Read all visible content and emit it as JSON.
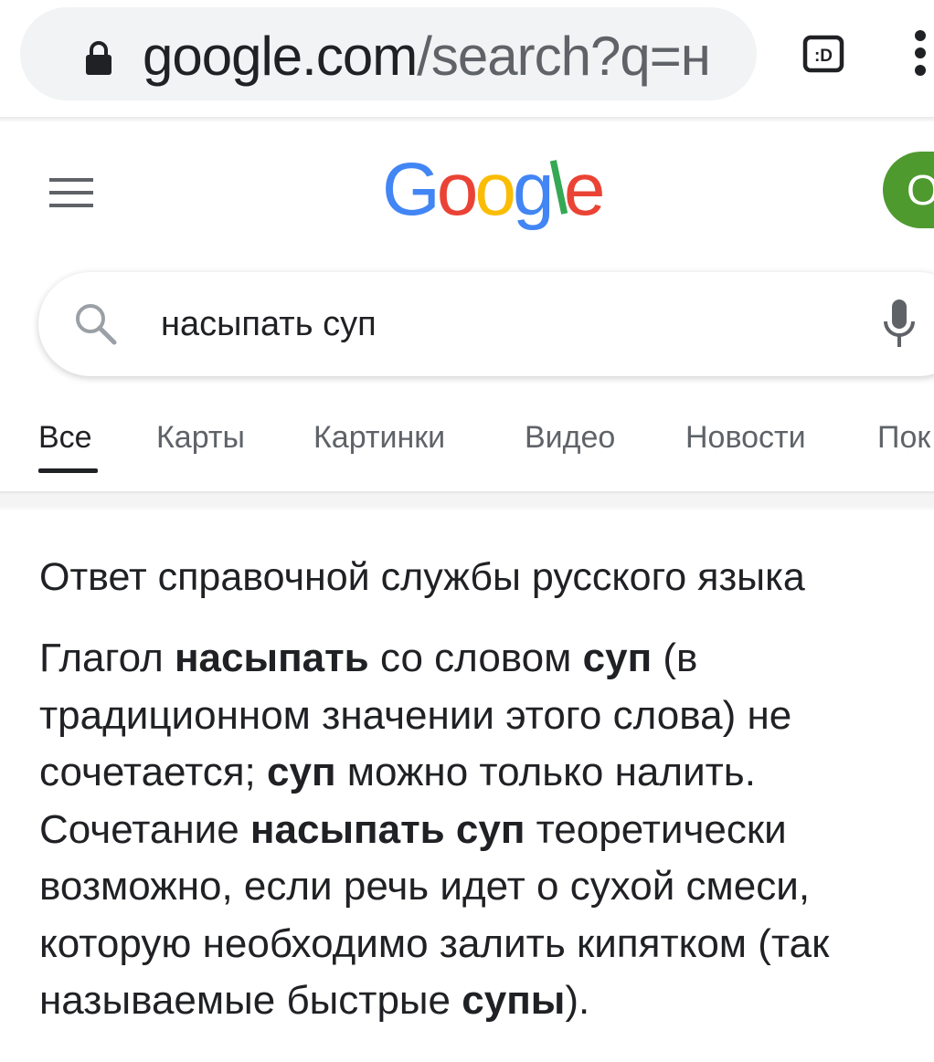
{
  "browser": {
    "url_host": "google.com",
    "url_rest": "/search?q=н",
    "tabs_icon_label": ":D",
    "icons": [
      "lock-icon",
      "tabs-icon",
      "more-vert-icon"
    ]
  },
  "header": {
    "logo_letters": [
      "G",
      "o",
      "o",
      "g",
      "l",
      "e"
    ],
    "logo_colors": [
      "#4285F4",
      "#EA4335",
      "#FBBC05",
      "#4285F4",
      "#34A853",
      "#EA4335"
    ],
    "avatar_letter": "О",
    "avatar_color": "#4e9a2f"
  },
  "search": {
    "query": "насыпать суп",
    "icons": [
      "search-icon",
      "mic-icon"
    ]
  },
  "tabs": [
    {
      "label": "Все",
      "active": true
    },
    {
      "label": "Карты",
      "active": false
    },
    {
      "label": "Картинки",
      "active": false
    },
    {
      "label": "Видео",
      "active": false
    },
    {
      "label": "Новости",
      "active": false
    },
    {
      "label": "Пок",
      "active": false
    }
  ],
  "answer": {
    "heading": "Ответ справочной службы русского языка",
    "lines": [
      [
        {
          "t": "Глагол "
        },
        {
          "t": "насыпать",
          "b": true
        },
        {
          "t": " со словом "
        },
        {
          "t": "суп",
          "b": true
        },
        {
          "t": " (в"
        }
      ],
      [
        {
          "t": "традиционном значении этого слова) не"
        }
      ],
      [
        {
          "t": "сочетается; "
        },
        {
          "t": "суп",
          "b": true
        },
        {
          "t": " можно только налить."
        }
      ],
      [
        {
          "t": "Сочетание "
        },
        {
          "t": "насыпать суп",
          "b": true
        },
        {
          "t": " теоретически"
        }
      ],
      [
        {
          "t": "возможно, если речь идет о сухой смеси,"
        }
      ],
      [
        {
          "t": "которую необходимо залить кипятком (так"
        }
      ],
      [
        {
          "t": "называемые быстрые "
        },
        {
          "t": "супы",
          "b": true
        },
        {
          "t": ")."
        }
      ]
    ]
  },
  "colors": {
    "text_primary": "#202124",
    "text_secondary": "#5f6368",
    "url_pill_bg": "#f1f3f4"
  }
}
